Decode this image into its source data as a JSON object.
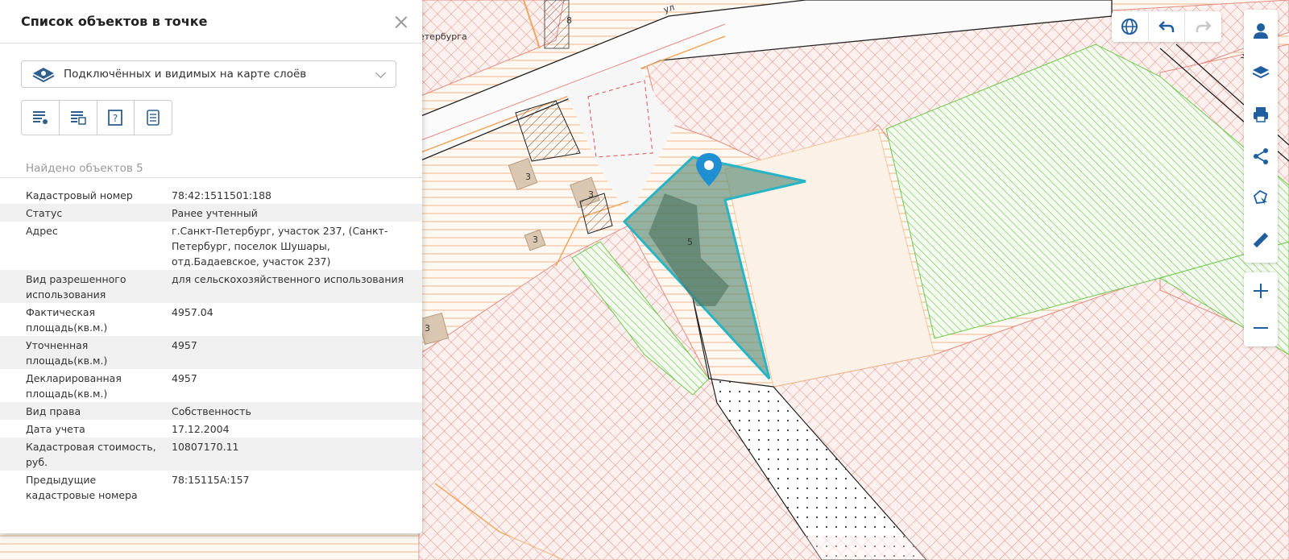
{
  "panel": {
    "title": "Список объектов в точке",
    "layer_select": "Подключённых и видимых на карте слоёв",
    "found": "Найдено объектов 5",
    "rows": [
      {
        "k": "Кадастровый номер",
        "v": "78:42:1511501:188"
      },
      {
        "k": "Статус",
        "v": "Ранее учтенный"
      },
      {
        "k": "Адрес",
        "v": "г.Санкт-Петербург, участок 237, (Санкт-Петербург, поселок Шушары, отд.Бадаевское, участок 237)"
      },
      {
        "k": "Вид разрешенного использования",
        "v": "для сельскохозяйственного использования"
      },
      {
        "k": "Фактическая площадь(кв.м.)",
        "v": "4957.04"
      },
      {
        "k": "Уточненная площадь(кв.м.)",
        "v": "4957"
      },
      {
        "k": "Декларированная площадь(кв.м.)",
        "v": "4957"
      },
      {
        "k": "Вид права",
        "v": "Собственность"
      },
      {
        "k": "Дата учета",
        "v": "17.12.2004"
      },
      {
        "k": "Кадастровая стоимость, руб.",
        "v": "10807170.11"
      },
      {
        "k": "Предыдущие кадастровые номера",
        "v": "78:15115А:157"
      }
    ]
  },
  "map": {
    "labels": {
      "parcel_8": "8",
      "parcel_3a": "3",
      "parcel_3b": "3",
      "parcel_3c": "3",
      "parcel_3d": "3",
      "parcel_5": "5",
      "road_spb": "етербурга",
      "road_ul": "ул",
      "road_ul2": "ул"
    },
    "colors": {
      "selected_outline": "#27b5c6",
      "red_hatch": "#e58a80",
      "green_hatch": "#6cc94a",
      "orange_hatch": "#f1b98a"
    }
  },
  "icons": {
    "globe": "globe-icon",
    "undo": "undo-icon",
    "redo": "redo-icon",
    "user": "user-icon",
    "layers": "layers-icon",
    "print": "print-icon",
    "share": "share-icon",
    "select": "select-area-icon",
    "ruler": "ruler-icon",
    "zoom_in": "zoom-in-icon",
    "zoom_out": "zoom-out-icon"
  }
}
